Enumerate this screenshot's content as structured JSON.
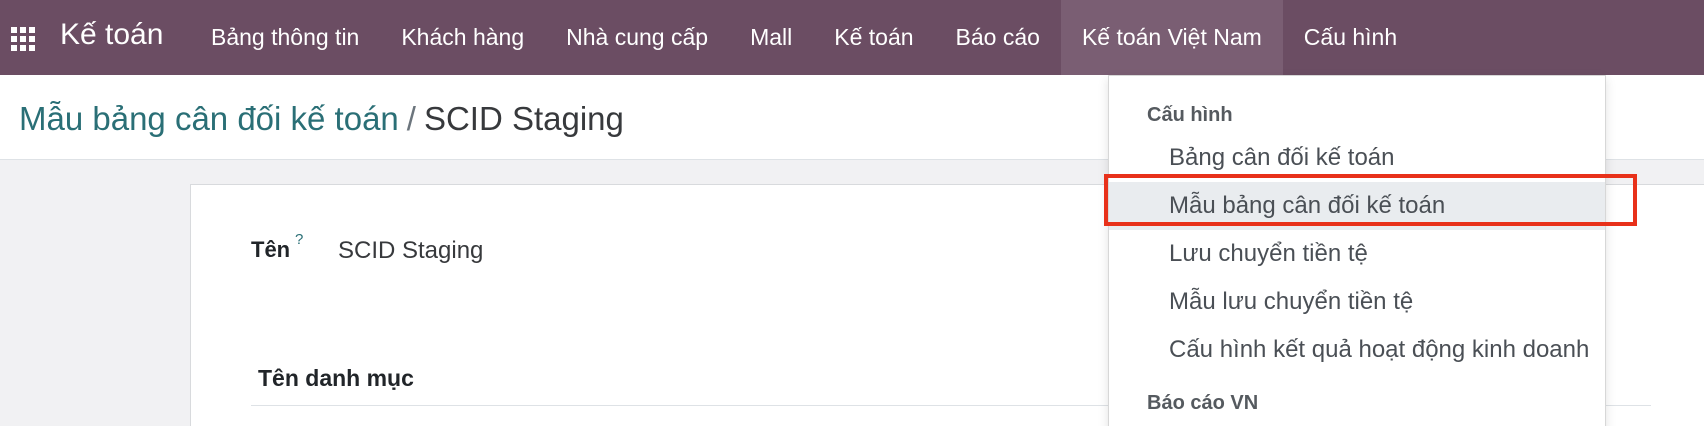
{
  "navbar": {
    "brand": "Kế toán",
    "menu": [
      {
        "label": "Bảng thông tin"
      },
      {
        "label": "Khách hàng"
      },
      {
        "label": "Nhà cung cấp"
      },
      {
        "label": "Mall"
      },
      {
        "label": "Kế toán"
      },
      {
        "label": "Báo cáo"
      },
      {
        "label": "Kế toán Việt Nam"
      },
      {
        "label": "Cấu hình"
      }
    ],
    "active_menu": "Kế toán Việt Nam"
  },
  "breadcrumb": {
    "parent": "Mẫu bảng cân đối kế toán",
    "separator": "/",
    "current": "SCID Staging"
  },
  "form": {
    "name_label": "Tên",
    "help_mark": "?",
    "name_value": "SCID Staging",
    "column_header": "Tên danh mục"
  },
  "dropdown": {
    "section1_header": "Cấu hình",
    "items": [
      {
        "label": "Bảng cân đối kế toán"
      },
      {
        "label": "Mẫu bảng cân đối kế toán"
      },
      {
        "label": "Lưu chuyển tiền tệ"
      },
      {
        "label": "Mẫu lưu chuyển tiền tệ"
      },
      {
        "label": "Cấu hình kết quả hoạt động kinh doanh"
      }
    ],
    "section2_header": "Báo cáo VN",
    "highlighted_item": "Mẫu bảng cân đối kế toán"
  },
  "colors": {
    "navbar": "#6b4d63",
    "link": "#2a6f76",
    "highlight": "#e8311a"
  },
  "icons": {
    "apps": "apps-grid-icon"
  }
}
